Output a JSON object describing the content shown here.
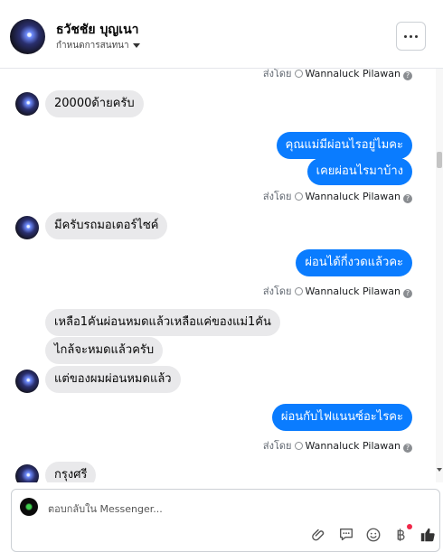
{
  "header": {
    "contact_name": "ธวัชชัย บุญเนา",
    "subtitle": "กำหนดการสนทนา"
  },
  "thread": {
    "top_sent_by": {
      "prefix": "ส่งโดย",
      "name": "Wannaluck Pilawan"
    },
    "messages": [
      {
        "direction": "in",
        "text": "20000ด้ายครับ"
      },
      {
        "direction": "out",
        "text": "คุณแม่มีผ่อนไรอยู่ไมคะ"
      },
      {
        "direction": "out",
        "text": "เคยผ่อนไรมาบ้าง"
      },
      {
        "direction": "meta",
        "prefix": "ส่งโดย",
        "name": "Wannaluck Pilawan"
      },
      {
        "direction": "in",
        "text": "มีครับรถมอเตอร์ไซค์"
      },
      {
        "direction": "out",
        "text": "ผ่อนได้กี่งวดแล้วคะ"
      },
      {
        "direction": "meta",
        "prefix": "ส่งโดย",
        "name": "Wannaluck Pilawan"
      },
      {
        "direction": "in",
        "text": "เหลือ1คันผ่อนหมดแล้วเหลือแค่ของแม่1คัน"
      },
      {
        "direction": "in",
        "text": "ไกล้จะหมดแล้วครับ"
      },
      {
        "direction": "in",
        "text": "แต่ของผมผ่อนหมดแล้ว"
      },
      {
        "direction": "out",
        "text": "ผ่อนกับไฟแนนซ์อะไรคะ"
      },
      {
        "direction": "meta",
        "prefix": "ส่งโดย",
        "name": "Wannaluck Pilawan"
      },
      {
        "direction": "in",
        "text": "กรุงศรี"
      }
    ]
  },
  "composer": {
    "placeholder": "ตอบกลับใน Messenger...",
    "tools": [
      "attach-icon",
      "saved-reply-icon",
      "emoji-icon",
      "baht-icon",
      "like-icon"
    ]
  },
  "colors": {
    "outgoing_bubble": "#0a7cff",
    "incoming_bubble": "#e9e9eb",
    "notification_dot": "#f02849"
  }
}
